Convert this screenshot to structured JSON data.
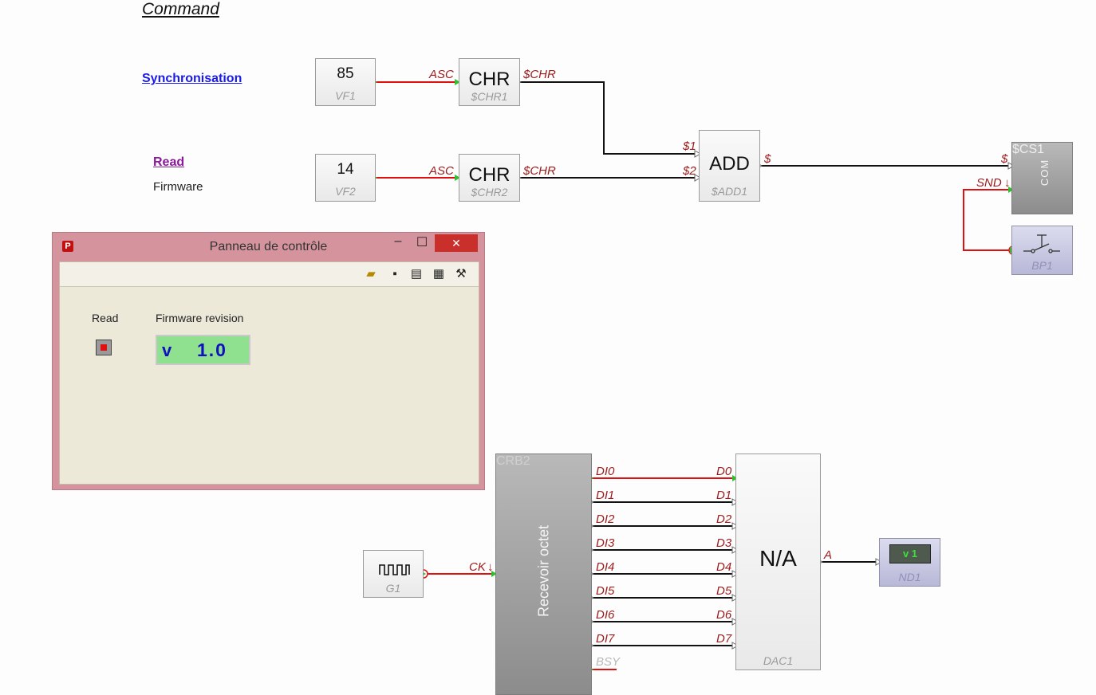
{
  "heading": "Command",
  "links": {
    "synchronisation": "Synchronisation",
    "read": "Read",
    "firmware": "Firmware"
  },
  "blocks": {
    "vf1": {
      "value": "85",
      "ref": "VF1"
    },
    "vf2": {
      "value": "14",
      "ref": "VF2"
    },
    "chr1": {
      "label": "CHR",
      "ref": "$CHR1",
      "in": "ASC",
      "out": "$CHR"
    },
    "chr2": {
      "label": "CHR",
      "ref": "$CHR2",
      "in": "ASC",
      "out": "$CHR"
    },
    "add1": {
      "label": "ADD",
      "ref": "$ADD1",
      "in1": "$1",
      "in2": "$2",
      "out": "$"
    },
    "cs1": {
      "label": "COM",
      "ref": "$CS1",
      "in": "$",
      "snd": "SND"
    },
    "bp1": {
      "ref": "BP1"
    },
    "g1": {
      "ref": "G1"
    },
    "crb2": {
      "label": "Recevoir octet",
      "ref": "CRB2",
      "ck": "CK",
      "bsy": "BSY",
      "outputs": [
        "DI0",
        "DI1",
        "DI2",
        "DI3",
        "DI4",
        "DI5",
        "DI6",
        "DI7"
      ]
    },
    "dac1": {
      "label": "N/A",
      "ref": "DAC1",
      "out": "A",
      "inputs": [
        "D0",
        "D1",
        "D2",
        "D3",
        "D4",
        "D5",
        "D6",
        "D7"
      ]
    },
    "nd1": {
      "display": "v 1",
      "ref": "ND1"
    }
  },
  "panel": {
    "title": "Panneau de contrôle",
    "read_label": "Read",
    "firmware_label": "Firmware revision",
    "firmware_prefix": "v",
    "firmware_value": "1.0",
    "window_buttons": {
      "minimize": "–",
      "maximize": "☐",
      "close": "✕"
    },
    "toolbar_icons": [
      "open-folder-icon",
      "save-icon",
      "print-icon",
      "paste-icon",
      "tools-icon"
    ]
  },
  "colors": {
    "active_wire": "#e01010",
    "wire": "#111111",
    "port_label": "#9b1c1c",
    "link_blue": "#1a1aee",
    "link_visited": "#8a1a9a",
    "panel_title_bar": "#d5949d",
    "display_green": "#8fe08f",
    "display_text": "#1010c0"
  }
}
